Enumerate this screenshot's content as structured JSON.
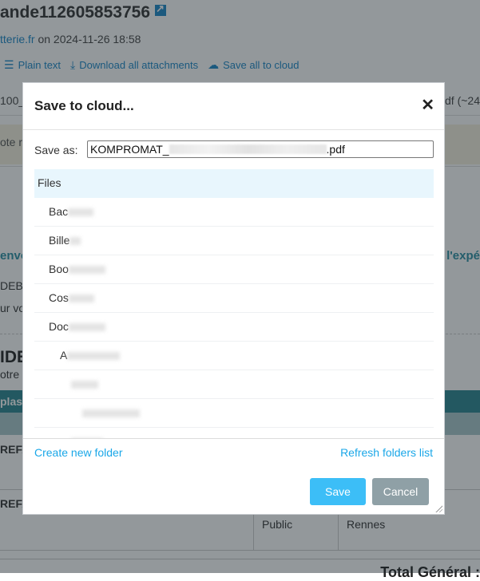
{
  "background": {
    "title": "ande112605853756",
    "sender_link": "tterie.fr",
    "sender_date": " on 2024-11-26 18:58",
    "toolbar": [
      {
        "icon": "list-icon",
        "label": "Plain text"
      },
      {
        "icon": "download-icon",
        "label": "Download all attachments"
      },
      {
        "icon": "cloud-icon",
        "label": "Save all to cloud"
      }
    ],
    "attachment_left": "100_",
    "attachment_right": "df (~24",
    "note_text": "ote r",
    "envo_text": "envo",
    "expe_text": "l'expé",
    "debo_text": "DEBO",
    "urvo_text": "ur vo",
    "ide_text": "IDE",
    "otre_text": "otre",
    "band_text": "plas",
    "row1_text": "REFA",
    "row2_text": "REFA",
    "row2_col2": "Public",
    "row2_col3": "Rennes",
    "total_label": "Total Général :"
  },
  "dialog": {
    "title": "Save to cloud...",
    "close_icon": "close-icon",
    "save_as_label": "Save as:",
    "save_as_prefix": "KOMPROMAT_",
    "save_as_suffix": ".pdf",
    "tree": [
      {
        "label": "Files",
        "level": 0,
        "selected": true
      },
      {
        "label": "Bac",
        "level": 1
      },
      {
        "label": "Bille",
        "level": 1
      },
      {
        "label": "Boo",
        "level": 1
      },
      {
        "label": "Cos",
        "level": 1
      },
      {
        "label": "Doc",
        "level": 1
      },
      {
        "label": "A",
        "level": 2
      },
      {
        "label": "",
        "level": 3
      },
      {
        "label": "",
        "level": 4
      },
      {
        "label": "",
        "level": 3
      }
    ],
    "create_folder_label": "Create new folder",
    "refresh_label": "Refresh folders list",
    "save_label": "Save",
    "cancel_label": "Cancel"
  }
}
